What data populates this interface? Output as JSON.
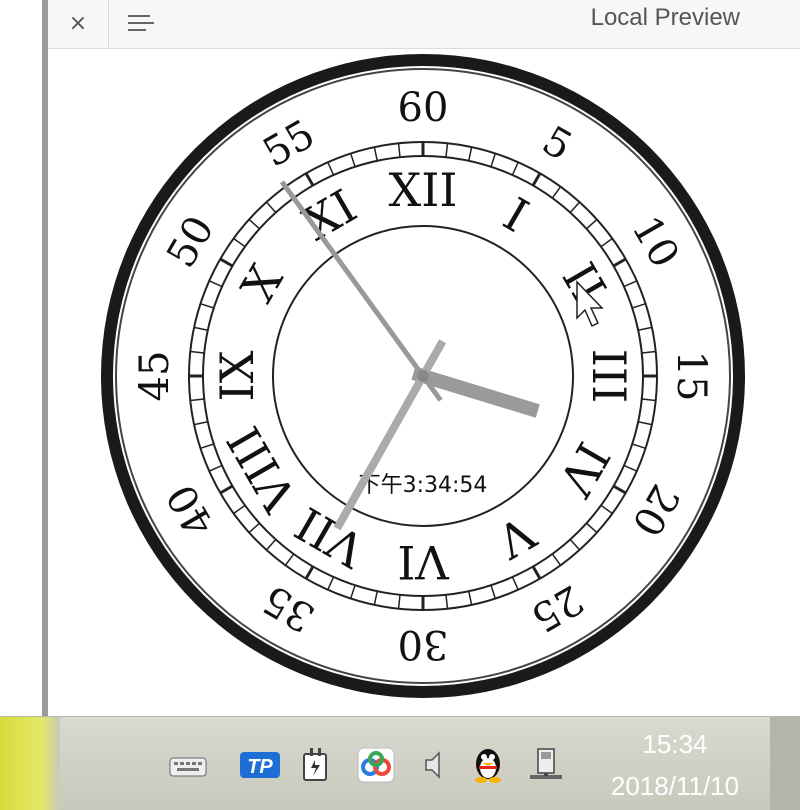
{
  "window": {
    "title": "Local Preview",
    "close_label": "×"
  },
  "clock": {
    "digital_time": "下午3:34:54",
    "hour_numerals": [
      "XII",
      "I",
      "II",
      "III",
      "IV",
      "V",
      "VI",
      "VII",
      "VIII",
      "IX",
      "X",
      "XI"
    ],
    "minute_labels": [
      "60",
      "5",
      "10",
      "15",
      "20",
      "25",
      "30",
      "35",
      "40",
      "45",
      "50",
      "55"
    ],
    "time": {
      "hours": 15,
      "minutes": 34,
      "seconds": 54
    }
  },
  "taskbar": {
    "time": "15:34",
    "date": "2018/11/10",
    "icons": [
      "keyboard-icon",
      "tp-icon",
      "power-plug-icon",
      "cloud-sync-icon",
      "speaker-icon",
      "qq-penguin-icon",
      "network-icon"
    ],
    "tp_label": "TP"
  }
}
